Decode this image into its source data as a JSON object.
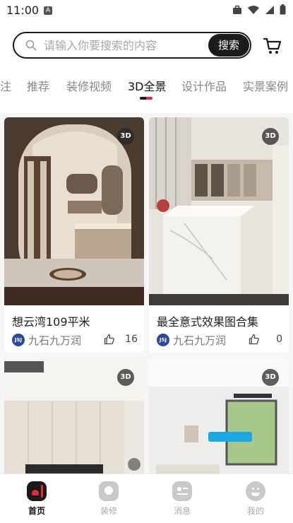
{
  "status_bar": {
    "time": "11:00",
    "notification_icon_letter": "A"
  },
  "search": {
    "placeholder": "请输入你要搜索的内容",
    "button_label": "搜索"
  },
  "tabs": [
    {
      "label": "注"
    },
    {
      "label": "推荐"
    },
    {
      "label": "装修视频"
    },
    {
      "label": "3D全景",
      "active": true
    },
    {
      "label": "设计作品"
    },
    {
      "label": "实景案例"
    }
  ],
  "feed": {
    "cards": [
      {
        "badge": "3D",
        "title": "想云湾109平米",
        "author": "九石九万润",
        "avatar_text": "JSJ",
        "likes": "16"
      },
      {
        "badge": "3D",
        "title": "最全意式效果图合集",
        "author": "九石九万润",
        "avatar_text": "JSJ",
        "likes": "0"
      },
      {
        "badge": "3D"
      },
      {
        "badge": "3D"
      }
    ]
  },
  "bottom_nav": [
    {
      "label": "首页",
      "icon": "home-icon",
      "active": true
    },
    {
      "label": "装修",
      "icon": "renovation-icon"
    },
    {
      "label": "消息",
      "icon": "message-icon"
    },
    {
      "label": "我的",
      "icon": "profile-icon"
    }
  ],
  "colors": {
    "accent_red": "#e02b3a",
    "dark": "#1c1c1c",
    "muted": "#a9a9a9"
  }
}
